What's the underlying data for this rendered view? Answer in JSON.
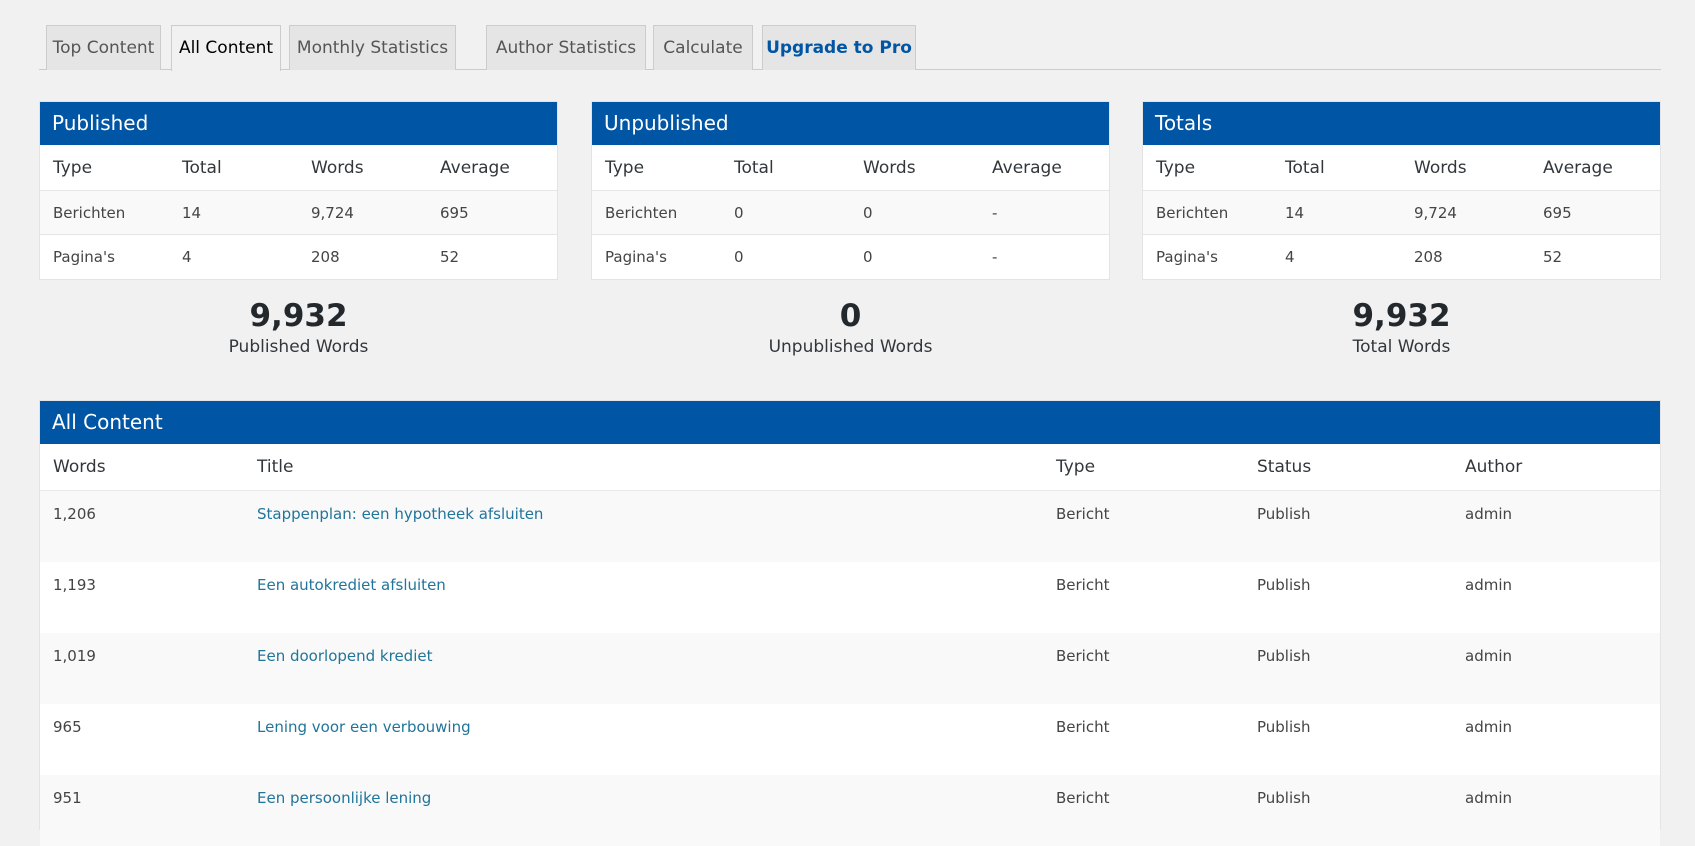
{
  "tabs": [
    "Top Content",
    "All Content",
    "Monthly Statistics",
    "Author Statistics",
    "Calculate",
    "Upgrade to Pro"
  ],
  "summary_columns": [
    "Type",
    "Total",
    "Words",
    "Average"
  ],
  "published": {
    "title": "Published",
    "rows": [
      [
        "Berichten",
        "14",
        "9,724",
        "695"
      ],
      [
        "Pagina's",
        "4",
        "208",
        "52"
      ]
    ],
    "big_value": "9,932",
    "big_label": "Published Words"
  },
  "unpublished": {
    "title": "Unpublished",
    "rows": [
      [
        "Berichten",
        "0",
        "0",
        "-"
      ],
      [
        "Pagina's",
        "0",
        "0",
        "-"
      ]
    ],
    "big_value": "0",
    "big_label": "Unpublished Words"
  },
  "totals": {
    "title": "Totals",
    "rows": [
      [
        "Berichten",
        "14",
        "9,724",
        "695"
      ],
      [
        "Pagina's",
        "4",
        "208",
        "52"
      ]
    ],
    "big_value": "9,932",
    "big_label": "Total Words"
  },
  "all_content": {
    "title": "All Content",
    "columns": [
      "Words",
      "Title",
      "Type",
      "Status",
      "Author"
    ],
    "rows": [
      [
        "1,206",
        "Stappenplan: een hypotheek afsluiten",
        "Bericht",
        "Publish",
        "admin"
      ],
      [
        "1,193",
        "Een autokrediet afsluiten",
        "Bericht",
        "Publish",
        "admin"
      ],
      [
        "1,019",
        "Een doorlopend krediet",
        "Bericht",
        "Publish",
        "admin"
      ],
      [
        "965",
        "Lening voor een verbouwing",
        "Bericht",
        "Publish",
        "admin"
      ],
      [
        "951",
        "Een persoonlijke lening",
        "Bericht",
        "Publish",
        "admin"
      ]
    ]
  },
  "colors": {
    "header_blue": "#0055a5",
    "link": "#21759b",
    "background": "#f1f1f1"
  }
}
